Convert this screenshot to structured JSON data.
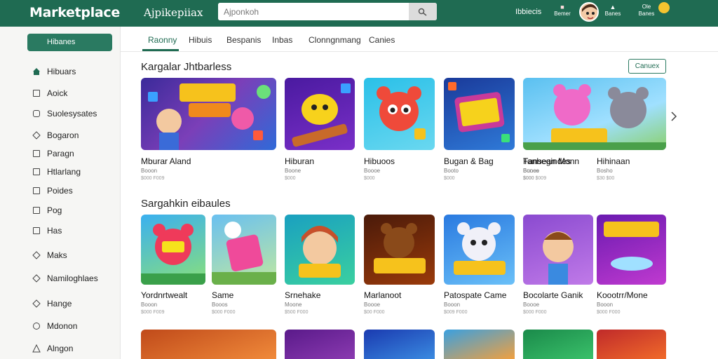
{
  "header": {
    "logo": "Marketplace",
    "subtitle": "Ajpikepiiax",
    "search_placeholder": "Ajponkoh",
    "link": "Ibbiecis",
    "mini1": "Bemer",
    "mini2": "Banes",
    "mini3_top": "Ole",
    "mini3_bottom": "Banes"
  },
  "sidebar": {
    "active": "Hibanes",
    "items": [
      "Hibuars",
      "Aoick",
      "Suolesysates",
      "Bogaron",
      "Paragn",
      "Htlarlang",
      "Poides",
      "Pog",
      "Has",
      "Maks",
      "Namiloghlaes",
      "Hange",
      "Mdonon",
      "Alngon"
    ]
  },
  "tabs": [
    "Raonny",
    "Hibuis",
    "Bespanis",
    "Inbas",
    "Clonngnmang",
    "Canies"
  ],
  "section1": {
    "title": "Kargalar Jhtbarless",
    "button": "Canuex",
    "cards": [
      {
        "title": "Mburar Aland",
        "sub": "Booon",
        "sub2": "$000 F009"
      },
      {
        "title": "Hiburan",
        "sub": "Boone",
        "sub2": "$000"
      },
      {
        "title": "Hibuoos",
        "sub": "Boooe",
        "sub2": "$000"
      },
      {
        "title": "Bugan & Bag",
        "sub": "Booto",
        "sub2": "$000"
      },
      {
        "title": "Fansean Monn",
        "sub": "Bunes",
        "sub2": "$000 $009"
      },
      {
        "title": "Tanbegindes",
        "sub": "Boooe",
        "sub2": "$000"
      },
      {
        "title": "Hihinaan",
        "sub": "Bosho",
        "sub2": "$30 $00"
      }
    ]
  },
  "section2": {
    "title": "Sargahkin eibaules",
    "cards": [
      {
        "title": "Yordnrtwealt",
        "sub": "Booon",
        "sub2": "$000 F009"
      },
      {
        "title": "Same",
        "sub": "Booos",
        "sub2": "$000 F000"
      },
      {
        "title": "Srnehake",
        "sub": "Moone",
        "sub2": "$500 F000"
      },
      {
        "title": "Marlanoot",
        "sub": "Boooe",
        "sub2": "$00 F000"
      },
      {
        "title": "Patospate Came",
        "sub": "Booon",
        "sub2": "$009 F000"
      },
      {
        "title": "Bocolarte Ganik",
        "sub": "Boooe",
        "sub2": "$000 F000"
      },
      {
        "title": "Koootrr/Mone",
        "sub": "Booon",
        "sub2": "$000 F000"
      }
    ]
  },
  "colors": {
    "brand": "#1f6b52",
    "accent": "#2a7a61"
  }
}
